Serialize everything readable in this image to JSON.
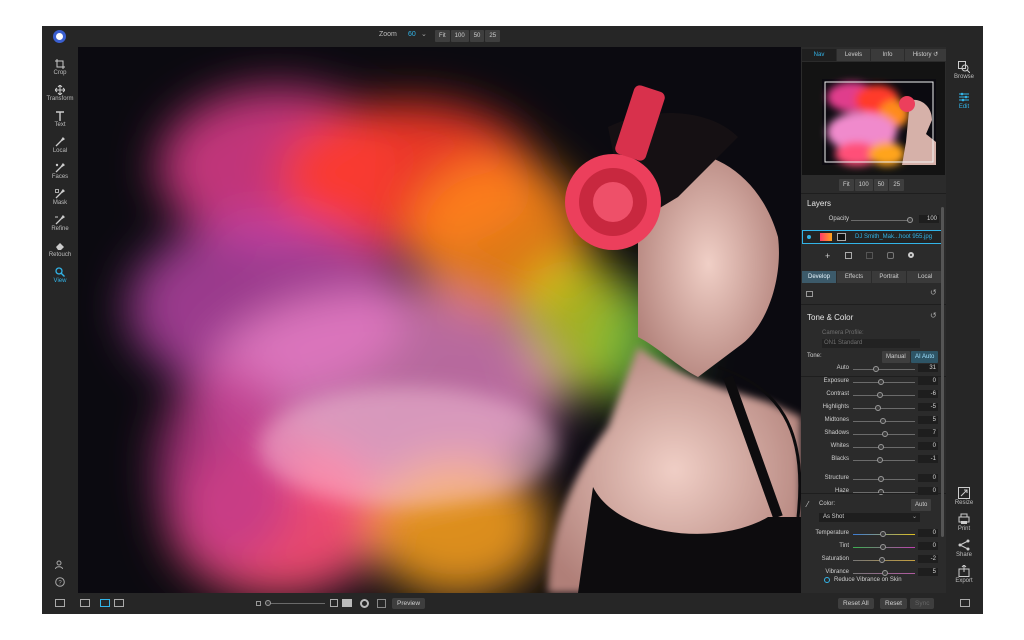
{
  "top": {
    "zoom_label": "Zoom",
    "zoom_value": "60",
    "zoom_buttons": [
      "Fit",
      "100",
      "50",
      "25"
    ]
  },
  "tools": [
    "Crop",
    "Transform",
    "Text",
    "Local",
    "Faces",
    "Mask",
    "Refine",
    "Retouch",
    "View"
  ],
  "active_tool": "View",
  "right_tools": [
    "Browse",
    "Edit",
    "Resize",
    "Print",
    "Share",
    "Export"
  ],
  "panel": {
    "nav_tabs": [
      "Nav",
      "Levels",
      "Info",
      "History"
    ],
    "nav_zoom": [
      "Fit",
      "100",
      "50",
      "25"
    ],
    "layers_title": "Layers",
    "opacity_label": "Opacity",
    "opacity_value": "100",
    "layer_name": "DJ Smith_Mak...hoot 955.jpg",
    "mode_tabs": [
      "Develop",
      "Effects",
      "Portrait",
      "Local"
    ],
    "tone_title": "Tone & Color",
    "camera_profile_label": "Camera Profile:",
    "camera_profile_value": "ON1 Standard",
    "tone_label": "Tone:",
    "tone_manual": "Manual",
    "tone_ai": "AI Auto",
    "auto": {
      "label": "Auto",
      "value": "31"
    },
    "sliders": [
      {
        "label": "Exposure",
        "value": "0"
      },
      {
        "label": "Contrast",
        "value": "-6"
      },
      {
        "label": "Highlights",
        "value": "-5"
      },
      {
        "label": "Midtones",
        "value": "5"
      },
      {
        "label": "Shadows",
        "value": "7"
      },
      {
        "label": "Whites",
        "value": "0"
      },
      {
        "label": "Blacks",
        "value": "-1"
      },
      {
        "label": "Structure",
        "value": "0"
      },
      {
        "label": "Haze",
        "value": "0"
      }
    ],
    "color_label": "Color:",
    "color_auto": "Auto",
    "white_balance": "As Shot",
    "color_sliders": [
      {
        "label": "Temperature",
        "value": "0"
      },
      {
        "label": "Tint",
        "value": "0"
      },
      {
        "label": "Saturation",
        "value": "-2"
      },
      {
        "label": "Vibrance",
        "value": "5"
      }
    ],
    "reduce_vibrance": "Reduce Vibrance on Skin"
  },
  "bottom": {
    "preview": "Preview",
    "reset_all": "Reset All",
    "reset": "Reset",
    "sync": "Sync"
  },
  "colors": {
    "accent": "#32b4e8",
    "bg": "#262626",
    "panel": "#2b2b2b"
  }
}
